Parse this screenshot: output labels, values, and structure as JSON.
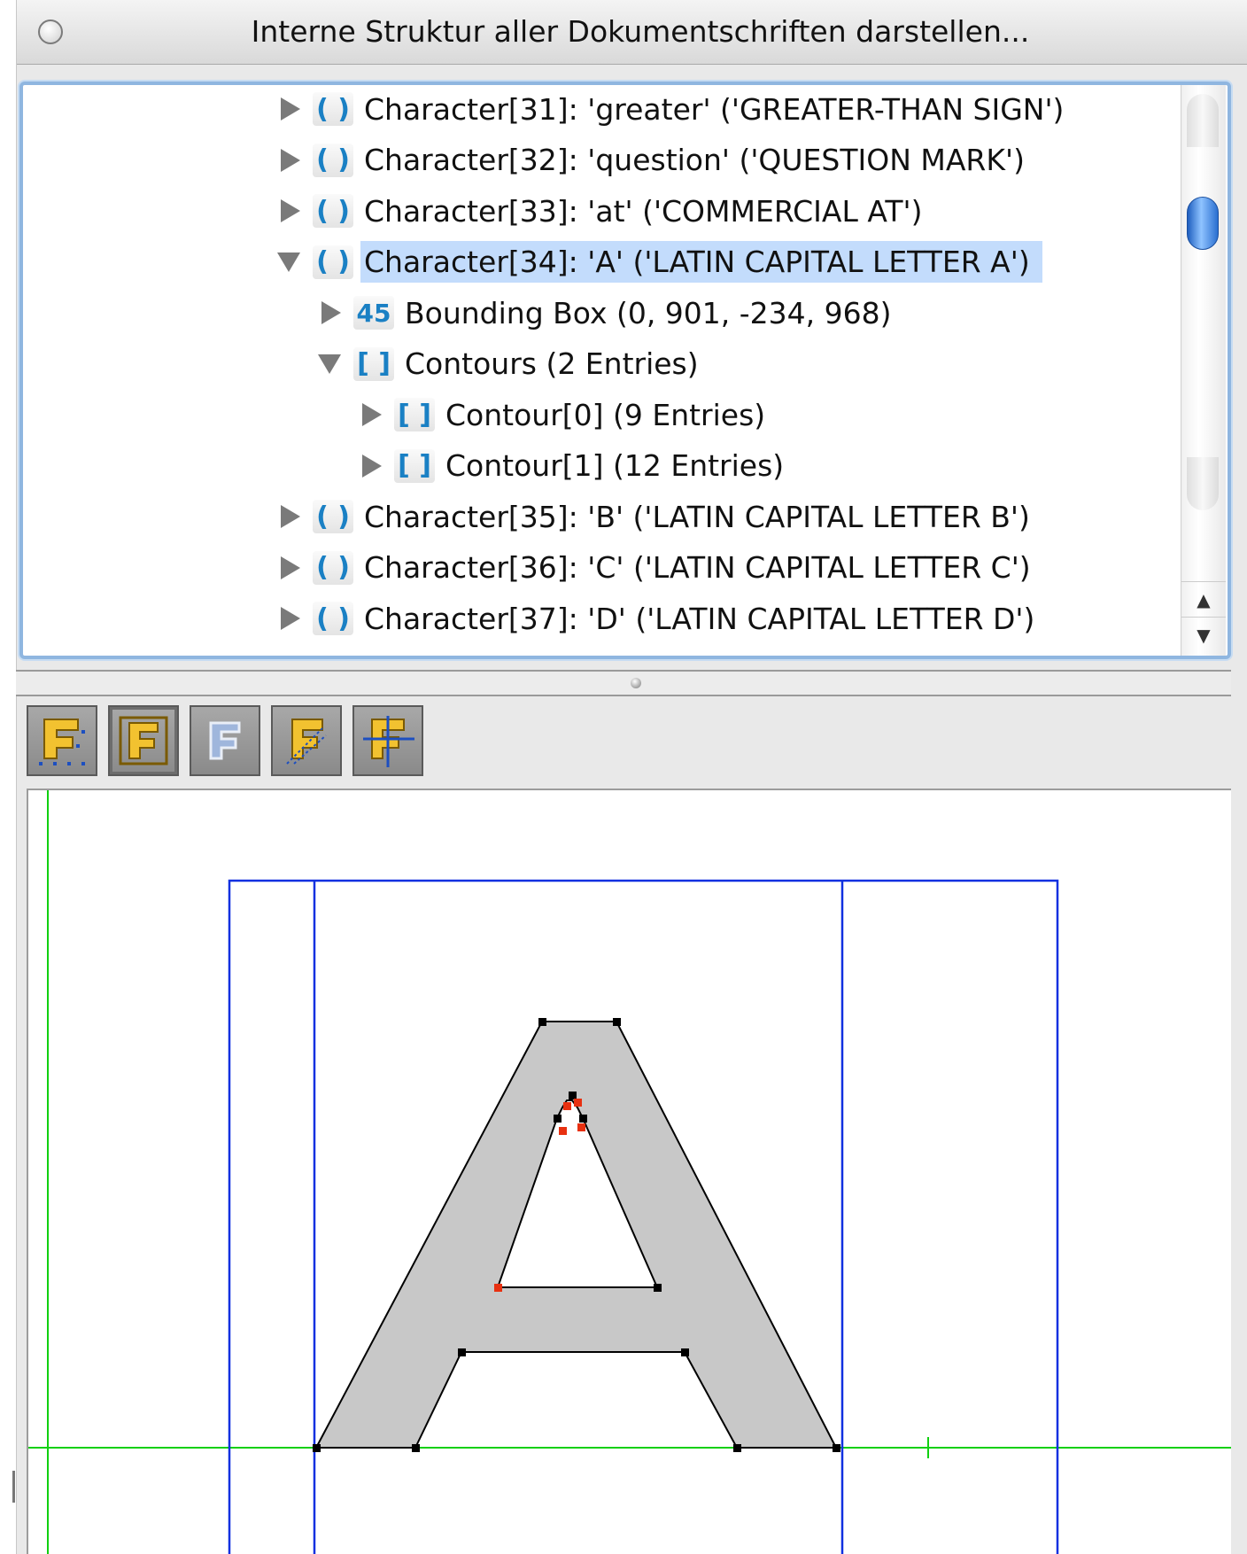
{
  "window": {
    "title": "Interne Struktur aller Dokumentschriften darstellen..."
  },
  "tree": {
    "rows": [
      {
        "expanded": false,
        "icon": "()",
        "label": "Character[31]: 'greater' ('GREATER-THAN SIGN')"
      },
      {
        "expanded": false,
        "icon": "()",
        "label": "Character[32]: 'question' ('QUESTION MARK')"
      },
      {
        "expanded": false,
        "icon": "()",
        "label": "Character[33]: 'at' ('COMMERCIAL AT')"
      },
      {
        "expanded": true,
        "icon": "()",
        "label": "Character[34]: 'A' ('LATIN CAPITAL LETTER A')",
        "selected": true
      },
      {
        "expanded": false,
        "icon": "45",
        "label": "Bounding Box (0, 901, -234, 968)"
      },
      {
        "expanded": true,
        "icon": "[]",
        "label": "Contours (2 Entries)"
      },
      {
        "expanded": false,
        "icon": "[]",
        "label": "Contour[0] (9 Entries)"
      },
      {
        "expanded": false,
        "icon": "[]",
        "label": "Contour[1] (12 Entries)"
      },
      {
        "expanded": false,
        "icon": "()",
        "label": "Character[35]: 'B' ('LATIN CAPITAL LETTER B')"
      },
      {
        "expanded": false,
        "icon": "()",
        "label": "Character[36]: 'C' ('LATIN CAPITAL LETTER C')"
      },
      {
        "expanded": false,
        "icon": "()",
        "label": "Character[37]: 'D' ('LATIN CAPITAL LETTER D')"
      }
    ]
  },
  "scrollbar": {
    "up": "▲",
    "down": "▼"
  },
  "toolbar": {
    "buttons": [
      {
        "name": "show-points-toggle",
        "glyph": "F"
      },
      {
        "name": "show-filled-toggle",
        "glyph": "F"
      },
      {
        "name": "show-outline-toggle",
        "glyph": "F"
      },
      {
        "name": "show-control-points-toggle",
        "glyph": "F"
      },
      {
        "name": "show-metrics-toggle",
        "glyph": "F"
      }
    ]
  },
  "colors": {
    "selection": "#c3dcfc",
    "icon_blue": "#1a80c4",
    "metric_blue": "#1030e0",
    "baseline_green": "#10d010",
    "glyph_fill": "#c8c8c8",
    "on_curve_point": "#000000",
    "off_curve_point": "#e83010"
  },
  "glyph_view": {
    "letter": "A",
    "outer_contour": "9 Entries",
    "inner_contour": "12 Entries"
  }
}
